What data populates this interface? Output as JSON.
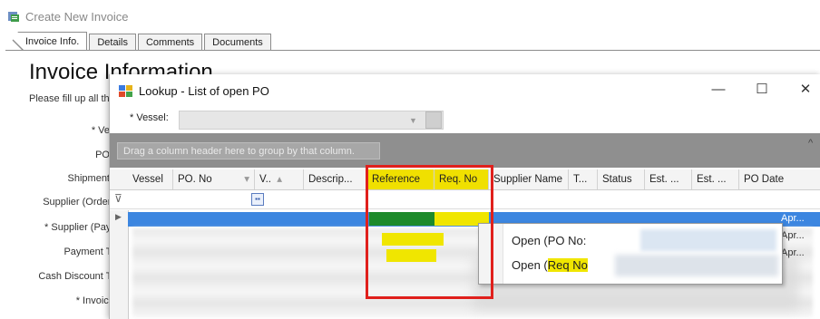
{
  "window": {
    "title": "Create New Invoice"
  },
  "tabs": [
    {
      "label": "Invoice Info."
    },
    {
      "label": "Details"
    },
    {
      "label": "Comments"
    },
    {
      "label": "Documents"
    }
  ],
  "page": {
    "heading": "Invoice Information",
    "subtitle": "Please fill up all th"
  },
  "form_labels": [
    "* Vess",
    "PO N",
    "Shipment N",
    "Supplier (Order T",
    "* Supplier (Pay T",
    "Payment Ter",
    "Cash Discount Ter",
    "* Invoice I"
  ],
  "dialog": {
    "title": "Lookup - List of open PO",
    "controls": {
      "minimize": "—",
      "maximize": "☐",
      "close": "✕"
    },
    "vessel_label": "* Vessel:",
    "group_hint": "Drag a column header here to group by that column.",
    "columns": [
      "Vessel",
      "PO. No",
      "V..",
      "Descrip...",
      "Reference",
      "Req. No",
      "Supplier Name",
      "T...",
      "Status",
      "Est. ...",
      "Est. ...",
      "PO Date"
    ],
    "column_sort_glyphs": {
      "po_no": "▾",
      "v": "▴"
    },
    "row_dates": [
      "Apr...",
      "Apr...",
      "Apr..."
    ]
  },
  "context_menu": {
    "items": [
      {
        "prefix": "Open (PO No:",
        "highlight": ""
      },
      {
        "prefix": "Open (",
        "highlight": "Req No",
        "suffix": ""
      }
    ]
  },
  "colors": {
    "highlight": "#f0e600",
    "red_box": "#e0201c",
    "selection": "#3c86e0",
    "green": "#1d8a2a"
  }
}
